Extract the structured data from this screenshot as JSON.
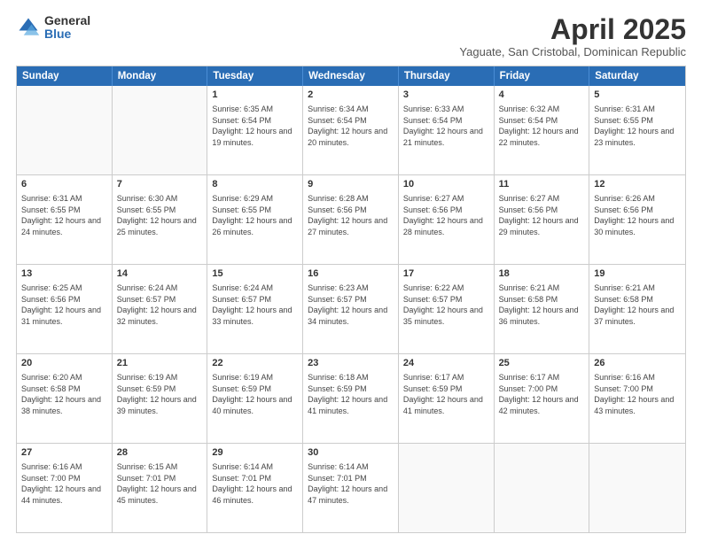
{
  "logo": {
    "general": "General",
    "blue": "Blue"
  },
  "title": {
    "month": "April 2025",
    "location": "Yaguate, San Cristobal, Dominican Republic"
  },
  "header_days": [
    "Sunday",
    "Monday",
    "Tuesday",
    "Wednesday",
    "Thursday",
    "Friday",
    "Saturday"
  ],
  "weeks": [
    [
      {
        "day": "",
        "info": ""
      },
      {
        "day": "",
        "info": ""
      },
      {
        "day": "1",
        "info": "Sunrise: 6:35 AM\nSunset: 6:54 PM\nDaylight: 12 hours and 19 minutes."
      },
      {
        "day": "2",
        "info": "Sunrise: 6:34 AM\nSunset: 6:54 PM\nDaylight: 12 hours and 20 minutes."
      },
      {
        "day": "3",
        "info": "Sunrise: 6:33 AM\nSunset: 6:54 PM\nDaylight: 12 hours and 21 minutes."
      },
      {
        "day": "4",
        "info": "Sunrise: 6:32 AM\nSunset: 6:54 PM\nDaylight: 12 hours and 22 minutes."
      },
      {
        "day": "5",
        "info": "Sunrise: 6:31 AM\nSunset: 6:55 PM\nDaylight: 12 hours and 23 minutes."
      }
    ],
    [
      {
        "day": "6",
        "info": "Sunrise: 6:31 AM\nSunset: 6:55 PM\nDaylight: 12 hours and 24 minutes."
      },
      {
        "day": "7",
        "info": "Sunrise: 6:30 AM\nSunset: 6:55 PM\nDaylight: 12 hours and 25 minutes."
      },
      {
        "day": "8",
        "info": "Sunrise: 6:29 AM\nSunset: 6:55 PM\nDaylight: 12 hours and 26 minutes."
      },
      {
        "day": "9",
        "info": "Sunrise: 6:28 AM\nSunset: 6:56 PM\nDaylight: 12 hours and 27 minutes."
      },
      {
        "day": "10",
        "info": "Sunrise: 6:27 AM\nSunset: 6:56 PM\nDaylight: 12 hours and 28 minutes."
      },
      {
        "day": "11",
        "info": "Sunrise: 6:27 AM\nSunset: 6:56 PM\nDaylight: 12 hours and 29 minutes."
      },
      {
        "day": "12",
        "info": "Sunrise: 6:26 AM\nSunset: 6:56 PM\nDaylight: 12 hours and 30 minutes."
      }
    ],
    [
      {
        "day": "13",
        "info": "Sunrise: 6:25 AM\nSunset: 6:56 PM\nDaylight: 12 hours and 31 minutes."
      },
      {
        "day": "14",
        "info": "Sunrise: 6:24 AM\nSunset: 6:57 PM\nDaylight: 12 hours and 32 minutes."
      },
      {
        "day": "15",
        "info": "Sunrise: 6:24 AM\nSunset: 6:57 PM\nDaylight: 12 hours and 33 minutes."
      },
      {
        "day": "16",
        "info": "Sunrise: 6:23 AM\nSunset: 6:57 PM\nDaylight: 12 hours and 34 minutes."
      },
      {
        "day": "17",
        "info": "Sunrise: 6:22 AM\nSunset: 6:57 PM\nDaylight: 12 hours and 35 minutes."
      },
      {
        "day": "18",
        "info": "Sunrise: 6:21 AM\nSunset: 6:58 PM\nDaylight: 12 hours and 36 minutes."
      },
      {
        "day": "19",
        "info": "Sunrise: 6:21 AM\nSunset: 6:58 PM\nDaylight: 12 hours and 37 minutes."
      }
    ],
    [
      {
        "day": "20",
        "info": "Sunrise: 6:20 AM\nSunset: 6:58 PM\nDaylight: 12 hours and 38 minutes."
      },
      {
        "day": "21",
        "info": "Sunrise: 6:19 AM\nSunset: 6:59 PM\nDaylight: 12 hours and 39 minutes."
      },
      {
        "day": "22",
        "info": "Sunrise: 6:19 AM\nSunset: 6:59 PM\nDaylight: 12 hours and 40 minutes."
      },
      {
        "day": "23",
        "info": "Sunrise: 6:18 AM\nSunset: 6:59 PM\nDaylight: 12 hours and 41 minutes."
      },
      {
        "day": "24",
        "info": "Sunrise: 6:17 AM\nSunset: 6:59 PM\nDaylight: 12 hours and 41 minutes."
      },
      {
        "day": "25",
        "info": "Sunrise: 6:17 AM\nSunset: 7:00 PM\nDaylight: 12 hours and 42 minutes."
      },
      {
        "day": "26",
        "info": "Sunrise: 6:16 AM\nSunset: 7:00 PM\nDaylight: 12 hours and 43 minutes."
      }
    ],
    [
      {
        "day": "27",
        "info": "Sunrise: 6:16 AM\nSunset: 7:00 PM\nDaylight: 12 hours and 44 minutes."
      },
      {
        "day": "28",
        "info": "Sunrise: 6:15 AM\nSunset: 7:01 PM\nDaylight: 12 hours and 45 minutes."
      },
      {
        "day": "29",
        "info": "Sunrise: 6:14 AM\nSunset: 7:01 PM\nDaylight: 12 hours and 46 minutes."
      },
      {
        "day": "30",
        "info": "Sunrise: 6:14 AM\nSunset: 7:01 PM\nDaylight: 12 hours and 47 minutes."
      },
      {
        "day": "",
        "info": ""
      },
      {
        "day": "",
        "info": ""
      },
      {
        "day": "",
        "info": ""
      }
    ]
  ]
}
